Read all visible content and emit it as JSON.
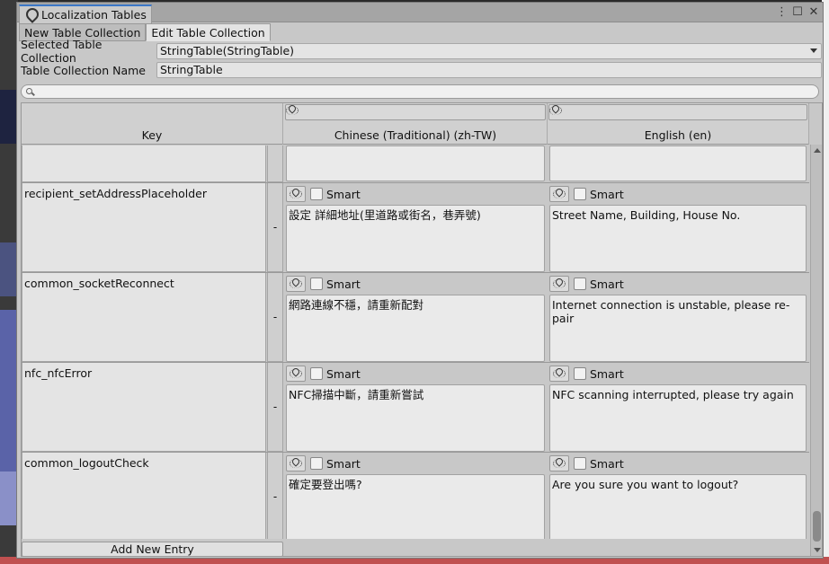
{
  "window": {
    "title": "Localization Tables",
    "controls": {
      "menu": "⋮",
      "maximize": "☐",
      "close": "✕"
    }
  },
  "tabs": [
    {
      "label": "New Table Collection",
      "active": false
    },
    {
      "label": "Edit Table Collection",
      "active": true
    }
  ],
  "fields": {
    "selected_table_collection_label": "Selected Table Collection",
    "selected_table_collection_value": "StringTable(StringTable)",
    "table_collection_name_label": "Table Collection Name",
    "table_collection_name_value": "StringTable"
  },
  "search": {
    "placeholder": "",
    "value": ""
  },
  "table": {
    "headers": {
      "key": "Key",
      "languages": [
        {
          "label": "Chinese (Traditional) (zh-TW)",
          "icon": "locale-icon"
        },
        {
          "label": "English (en)",
          "icon": "locale-icon"
        }
      ]
    },
    "smart_label": "Smart",
    "remove_label": "-",
    "rows": [
      {
        "key": "recipient_setAddressPlaceholder",
        "zh": "設定 詳細地址(里道路或街名，巷弄號)",
        "en": "Street Name, Building, House No.",
        "smart_zh": false,
        "smart_en": false
      },
      {
        "key": "common_socketReconnect",
        "zh": "網路連線不穩，請重新配對",
        "en": "Internet connection is unstable, please re-pair",
        "smart_zh": false,
        "smart_en": false
      },
      {
        "key": "nfc_nfcError",
        "zh": "NFC掃描中斷，請重新嘗試",
        "en": "NFC scanning interrupted, please try again",
        "smart_zh": false,
        "smart_en": false
      },
      {
        "key": "common_logoutCheck",
        "zh": "確定要登出嗎?",
        "en": "Are you sure you want to logout?",
        "smart_zh": false,
        "smart_en": false
      }
    ],
    "add_entry_label": "Add New Entry"
  }
}
